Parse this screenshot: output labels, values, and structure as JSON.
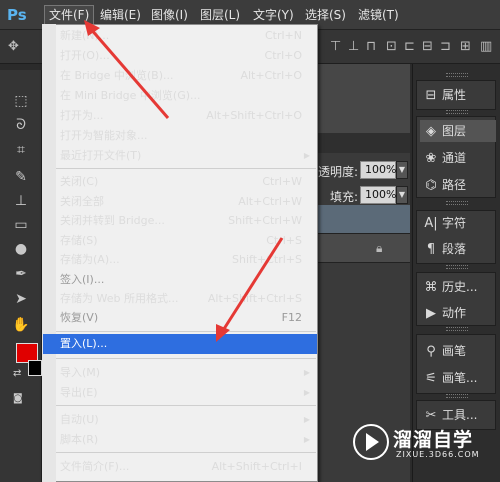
{
  "app": {
    "logo": "Ps"
  },
  "menubar": {
    "items": [
      "文件(F)",
      "编辑(E)",
      "图像(I)",
      "图层(L)",
      "文字(Y)",
      "选择(S)",
      "滤镜(T)"
    ]
  },
  "file_menu": {
    "groups": [
      [
        {
          "label": "新建(N)...",
          "shortcut": "Ctrl+N"
        },
        {
          "label": "打开(O)...",
          "shortcut": "Ctrl+O"
        },
        {
          "label": "在 Bridge 中浏览(B)...",
          "shortcut": "Alt+Ctrl+O"
        },
        {
          "label": "在 Mini Bridge 中浏览(G)...",
          "shortcut": ""
        },
        {
          "label": "打开为...",
          "shortcut": "Alt+Shift+Ctrl+O"
        },
        {
          "label": "打开为智能对象...",
          "shortcut": ""
        },
        {
          "label": "最近打开文件(T)",
          "shortcut": "",
          "submenu": true
        }
      ],
      [
        {
          "label": "关闭(C)",
          "shortcut": "Ctrl+W"
        },
        {
          "label": "关闭全部",
          "shortcut": "Alt+Ctrl+W"
        },
        {
          "label": "关闭并转到 Bridge...",
          "shortcut": "Shift+Ctrl+W"
        },
        {
          "label": "存储(S)",
          "shortcut": "Ctrl+S"
        },
        {
          "label": "存储为(A)...",
          "shortcut": "Shift+Ctrl+S"
        },
        {
          "label": "签入(I)...",
          "shortcut": "",
          "disabled": true
        },
        {
          "label": "存储为 Web 所用格式...",
          "shortcut": "Alt+Shift+Ctrl+S"
        },
        {
          "label": "恢复(V)",
          "shortcut": "F12",
          "disabled": true
        }
      ],
      [
        {
          "label": "置入(L)...",
          "shortcut": "",
          "highlighted": true
        }
      ],
      [
        {
          "label": "导入(M)",
          "shortcut": "",
          "submenu": true
        },
        {
          "label": "导出(E)",
          "shortcut": "",
          "submenu": true
        }
      ],
      [
        {
          "label": "自动(U)",
          "shortcut": "",
          "submenu": true
        },
        {
          "label": "脚本(R)",
          "shortcut": "",
          "submenu": true
        }
      ],
      [
        {
          "label": "文件简介(F)...",
          "shortcut": "Alt+Shift+Ctrl+I"
        }
      ]
    ]
  },
  "layers": {
    "opacity_label": "透明度:",
    "opacity_value": "100%",
    "fill_label": "填充:",
    "fill_value": "100%"
  },
  "dock": {
    "items": [
      {
        "icon": "properties-icon",
        "label": "属性"
      },
      {
        "icon": "layers-icon",
        "label": "图层"
      },
      {
        "icon": "channels-icon",
        "label": "通道"
      },
      {
        "icon": "paths-icon",
        "label": "路径"
      },
      {
        "icon": "character-icon",
        "label": "字符"
      },
      {
        "icon": "paragraph-icon",
        "label": "段落"
      },
      {
        "icon": "history-icon",
        "label": "历史..."
      },
      {
        "icon": "actions-icon",
        "label": "动作"
      },
      {
        "icon": "brush-icon",
        "label": "画笔"
      },
      {
        "icon": "brush-presets-icon",
        "label": "画笔..."
      },
      {
        "icon": "tool-presets-icon",
        "label": "工具..."
      }
    ]
  },
  "watermark": {
    "brand": "溜溜自学",
    "url": "ZIXUE.3D66.COM"
  },
  "colors": {
    "foreground": "#e00000",
    "background": "#000000",
    "highlight": "#2e6ee0",
    "annotation_arrow": "#e53935"
  }
}
